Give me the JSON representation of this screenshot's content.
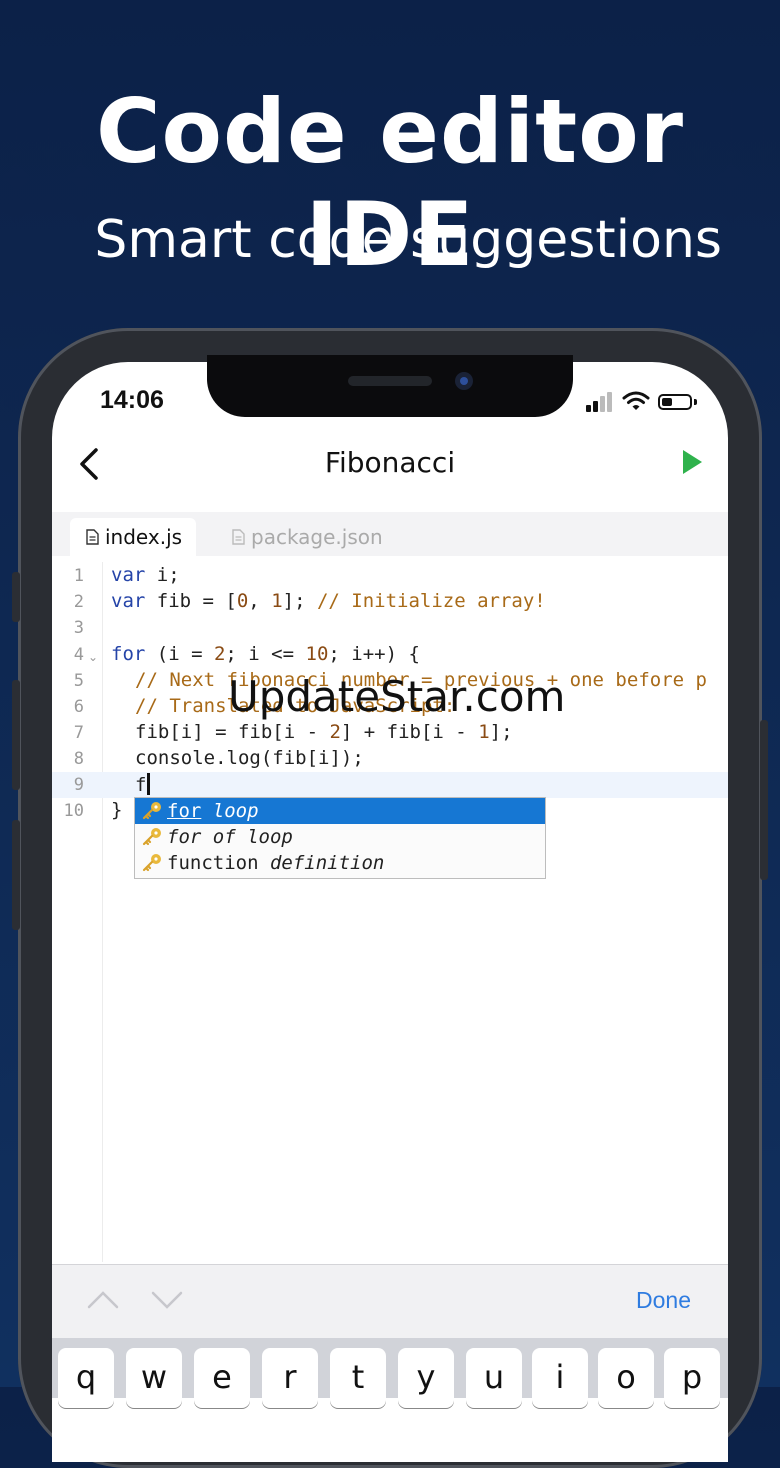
{
  "banner": {
    "title": "Code editor IDE",
    "subtitle": "Smart code suggestions"
  },
  "status_bar": {
    "time": "14:06"
  },
  "nav": {
    "title": "Fibonacci"
  },
  "tabs": [
    {
      "label": "index.js",
      "active": true
    },
    {
      "label": "package.json",
      "active": false
    }
  ],
  "editor": {
    "lines": [
      {
        "num": "1"
      },
      {
        "num": "2"
      },
      {
        "num": "3"
      },
      {
        "num": "4"
      },
      {
        "num": "5"
      },
      {
        "num": "6"
      },
      {
        "num": "7"
      },
      {
        "num": "8"
      },
      {
        "num": "9"
      },
      {
        "num": "10"
      }
    ],
    "code": {
      "l1_kw": "var",
      "l1_rest": " i;",
      "l2_kw": "var",
      "l2_a": " fib = [",
      "l2_n0": "0",
      "l2_b": ", ",
      "l2_n1": "1",
      "l2_c": "]; ",
      "l2_cm": "// Initialize array!",
      "l4_kw": "for",
      "l4_a": " (i = ",
      "l4_n2": "2",
      "l4_b": "; i <= ",
      "l4_n10": "10",
      "l4_c": "; i++) {",
      "l5_cm": "// Next fibonacci number = previous + one before p",
      "l6_cm": "// Translated to JavaScript:",
      "l7_a": "fib[i] = fib[i - ",
      "l7_n2": "2",
      "l7_b": "] + fib[i - ",
      "l7_n1": "1",
      "l7_c": "];",
      "l8": "console.log(fib[i]);",
      "l9": "f",
      "l10": "}"
    },
    "current_line": "9"
  },
  "autocomplete": [
    {
      "keyword": "for",
      "rest": "loop",
      "selected": true
    },
    {
      "keyword": "for of",
      "rest": "loop",
      "selected": false
    },
    {
      "keyword": "function",
      "rest": "definition",
      "selected": false
    }
  ],
  "watermark": "UpdateStar.com",
  "keyboard_toolbar": {
    "done_label": "Done"
  },
  "keyboard": {
    "keys": [
      "q",
      "w",
      "e",
      "r",
      "t",
      "y",
      "u",
      "i",
      "o",
      "p"
    ]
  },
  "colors": {
    "background": "#0c2148",
    "accent": "#1677d3",
    "run": "#2fb24c",
    "keyword": "#2544a8",
    "comment": "#a86a18"
  }
}
